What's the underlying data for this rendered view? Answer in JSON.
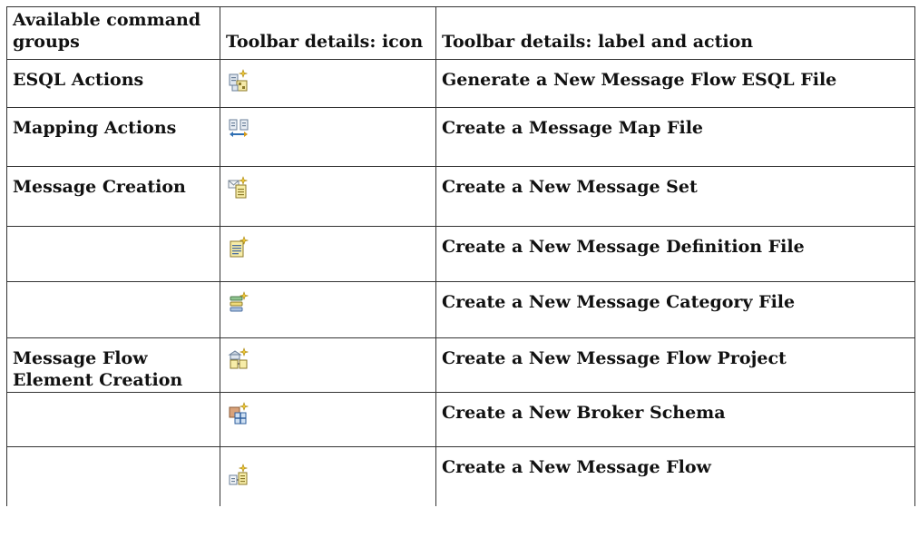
{
  "headers": {
    "col1": "Available command groups",
    "col2": "Toolbar details: icon",
    "col3": "Toolbar details: label and action"
  },
  "rows": [
    {
      "group": "ESQL Actions",
      "icon": "esql-file-new-icon",
      "label": "Generate a New Message Flow ESQL File"
    },
    {
      "group": "Mapping Actions",
      "icon": "message-map-new-icon",
      "label": "Create a Message Map File"
    },
    {
      "group": "Message Creation",
      "icon": "message-set-new-icon",
      "label": "Create a New Message Set"
    },
    {
      "group": "",
      "icon": "message-definition-new-icon",
      "label": "Create a New Message Definition File"
    },
    {
      "group": "",
      "icon": "message-category-new-icon",
      "label": "Create a New Message Category File"
    },
    {
      "group": "Message Flow Element Creation",
      "icon": "message-flow-project-new-icon",
      "label": "Create a New Message Flow Project"
    },
    {
      "group": "",
      "icon": "broker-schema-new-icon",
      "label": "Create a New Broker Schema"
    },
    {
      "group": "",
      "icon": "message-flow-new-icon",
      "label": "Create a New Message Flow"
    }
  ]
}
